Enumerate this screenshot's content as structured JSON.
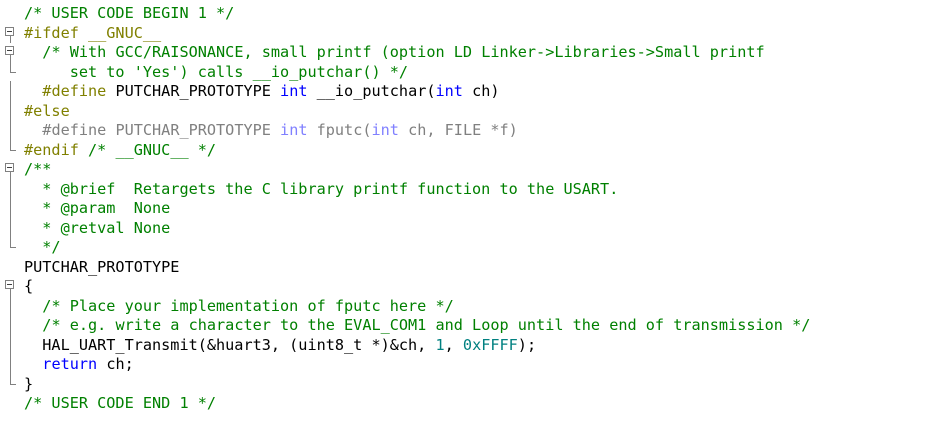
{
  "lines": [
    {
      "fold": "none",
      "tokens": [
        {
          "c": "cm",
          "t": "/* USER CODE BEGIN 1 */"
        }
      ]
    },
    {
      "fold": "start",
      "tokens": [
        {
          "c": "pp",
          "t": "#ifdef __GNUC__"
        }
      ]
    },
    {
      "fold": "start",
      "tokens": [
        {
          "c": "tx",
          "t": "  "
        },
        {
          "c": "cm",
          "t": "/* With GCC/RAISONANCE, small printf (option LD Linker->Libraries->Small printf"
        }
      ]
    },
    {
      "fold": "end",
      "tokens": [
        {
          "c": "cm",
          "t": "     set to 'Yes') calls __io_putchar() */"
        }
      ]
    },
    {
      "fold": "line",
      "tokens": [
        {
          "c": "tx",
          "t": "  "
        },
        {
          "c": "pp",
          "t": "#define"
        },
        {
          "c": "tx",
          "t": " PUTCHAR_PROTOTYPE "
        },
        {
          "c": "kw",
          "t": "int"
        },
        {
          "c": "tx",
          "t": " __io_putchar("
        },
        {
          "c": "kw",
          "t": "int"
        },
        {
          "c": "tx",
          "t": " ch)"
        }
      ]
    },
    {
      "fold": "line",
      "tokens": [
        {
          "c": "pp",
          "t": "#else"
        }
      ]
    },
    {
      "fold": "line",
      "tokens": [
        {
          "c": "tx",
          "t": "  "
        },
        {
          "c": "gray-pp",
          "t": "#define"
        },
        {
          "c": "gray",
          "t": " PUTCHAR_PROTOTYPE "
        },
        {
          "c": "gray-kw",
          "t": "int"
        },
        {
          "c": "gray",
          "t": " fputc("
        },
        {
          "c": "gray-kw",
          "t": "int"
        },
        {
          "c": "gray",
          "t": " ch, FILE *f)"
        }
      ]
    },
    {
      "fold": "end",
      "tokens": [
        {
          "c": "pp",
          "t": "#endif"
        },
        {
          "c": "tx",
          "t": " "
        },
        {
          "c": "cm",
          "t": "/* __GNUC__ */"
        }
      ]
    },
    {
      "fold": "start",
      "tokens": [
        {
          "c": "cm",
          "t": "/**"
        }
      ]
    },
    {
      "fold": "line",
      "tokens": [
        {
          "c": "cm",
          "t": "  * @brief  Retargets the C library printf function to the USART."
        }
      ]
    },
    {
      "fold": "line",
      "tokens": [
        {
          "c": "cm",
          "t": "  * @param  None"
        }
      ]
    },
    {
      "fold": "line",
      "tokens": [
        {
          "c": "cm",
          "t": "  * @retval None"
        }
      ]
    },
    {
      "fold": "end",
      "tokens": [
        {
          "c": "cm",
          "t": "  */"
        }
      ]
    },
    {
      "fold": "none",
      "tokens": [
        {
          "c": "tx",
          "t": "PUTCHAR_PROTOTYPE"
        }
      ]
    },
    {
      "fold": "start",
      "tokens": [
        {
          "c": "tx",
          "t": "{"
        }
      ]
    },
    {
      "fold": "line",
      "tokens": [
        {
          "c": "tx",
          "t": "  "
        },
        {
          "c": "cm",
          "t": "/* Place your implementation of fputc here */"
        }
      ]
    },
    {
      "fold": "line",
      "tokens": [
        {
          "c": "tx",
          "t": "  "
        },
        {
          "c": "cm",
          "t": "/* e.g. write a character to the EVAL_COM1 and Loop until the end of transmission */"
        }
      ]
    },
    {
      "fold": "line",
      "tokens": [
        {
          "c": "tx",
          "t": "  HAL_UART_Transmit(&huart3, (uint8_t *)&ch, "
        },
        {
          "c": "num",
          "t": "1"
        },
        {
          "c": "tx",
          "t": ", "
        },
        {
          "c": "num",
          "t": "0xFFFF"
        },
        {
          "c": "tx",
          "t": ");"
        }
      ]
    },
    {
      "fold": "line",
      "tokens": [
        {
          "c": "tx",
          "t": "  "
        },
        {
          "c": "kw",
          "t": "return"
        },
        {
          "c": "tx",
          "t": " ch;"
        }
      ]
    },
    {
      "fold": "end",
      "tokens": [
        {
          "c": "tx",
          "t": "}"
        }
      ]
    },
    {
      "fold": "none",
      "tokens": [
        {
          "c": "cm",
          "t": "/* USER CODE END 1 */"
        }
      ]
    }
  ]
}
